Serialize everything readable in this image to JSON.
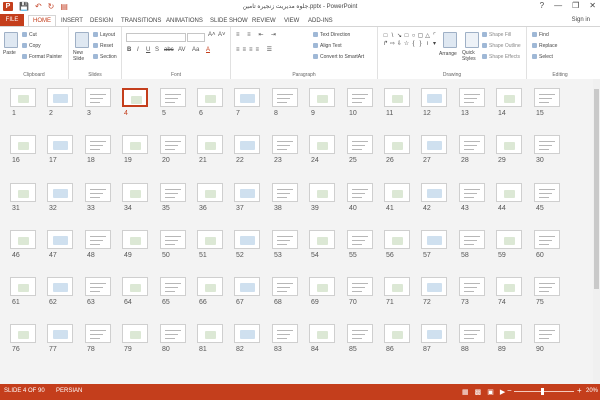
{
  "window": {
    "title": "جلوه مديريت زنجيره تامين.pptx - PowerPoint",
    "controls": [
      "?",
      "—",
      "❐",
      "✕"
    ]
  },
  "qat": {
    "app_icon": "P",
    "items": [
      "save-icon",
      "undo-icon",
      "redo-icon",
      "start-from-beginning-icon"
    ]
  },
  "tabs": [
    "FILE",
    "HOME",
    "INSERT",
    "DESIGN",
    "TRANSITIONS",
    "ANIMATIONS",
    "SLIDE SHOW",
    "REVIEW",
    "VIEW",
    "ADD-INS"
  ],
  "active_tab": "HOME",
  "signin": "Sign in",
  "ribbon": {
    "clipboard": {
      "label": "Clipboard",
      "paste": "Paste",
      "cut": "Cut",
      "copy": "Copy",
      "format_painter": "Format Painter"
    },
    "slides": {
      "label": "Slides",
      "new_slide": "New Slide",
      "layout": "Layout",
      "reset": "Reset",
      "section": "Section"
    },
    "font": {
      "label": "Font",
      "bold": "B",
      "italic": "I",
      "underline": "U",
      "shadow": "S",
      "strike": "abc",
      "spacing": "AV",
      "case": "Aa",
      "color": "A"
    },
    "paragraph": {
      "label": "Paragraph",
      "text_direction": "Text Direction",
      "align_text": "Align Text",
      "convert_smartart": "Convert to SmartArt"
    },
    "drawing": {
      "label": "Drawing",
      "arrange": "Arrange",
      "quick_styles": "Quick Styles",
      "shape_fill": "Shape Fill",
      "shape_outline": "Shape Outline",
      "shape_effects": "Shape Effects"
    },
    "editing": {
      "label": "Editing",
      "find": "Find",
      "replace": "Replace",
      "select": "Select"
    }
  },
  "slides": {
    "rows": [
      [
        "1",
        "2",
        "3",
        "4",
        "5",
        "6",
        "7",
        "8",
        "9",
        "10",
        "11",
        "12",
        "13",
        "14",
        "15"
      ],
      [
        "16",
        "17",
        "18",
        "19",
        "20",
        "21",
        "22",
        "23",
        "24",
        "25",
        "26",
        "27",
        "28",
        "29",
        "30"
      ],
      [
        "31",
        "32",
        "33",
        "34",
        "35",
        "36",
        "37",
        "38",
        "39",
        "40",
        "41",
        "42",
        "43",
        "44",
        "45"
      ],
      [
        "46",
        "47",
        "48",
        "49",
        "50",
        "51",
        "52",
        "53",
        "54",
        "55",
        "56",
        "57",
        "58",
        "59",
        "60"
      ],
      [
        "61",
        "62",
        "63",
        "64",
        "65",
        "66",
        "67",
        "68",
        "69",
        "70",
        "71",
        "72",
        "73",
        "74",
        "75"
      ],
      [
        "76",
        "77",
        "78",
        "79",
        "80",
        "81",
        "82",
        "83",
        "84",
        "85",
        "86",
        "87",
        "88",
        "89",
        "90"
      ]
    ],
    "selected": "4"
  },
  "status": {
    "slide": "SLIDE 4 OF 90",
    "language": "PERSIAN",
    "zoom": "20%",
    "zoom_minus": "−",
    "zoom_plus": "+"
  },
  "colors": {
    "accent": "#c43e1c",
    "status_bar": "#c43e1c",
    "sorter_bg": "#f3f3f3"
  }
}
